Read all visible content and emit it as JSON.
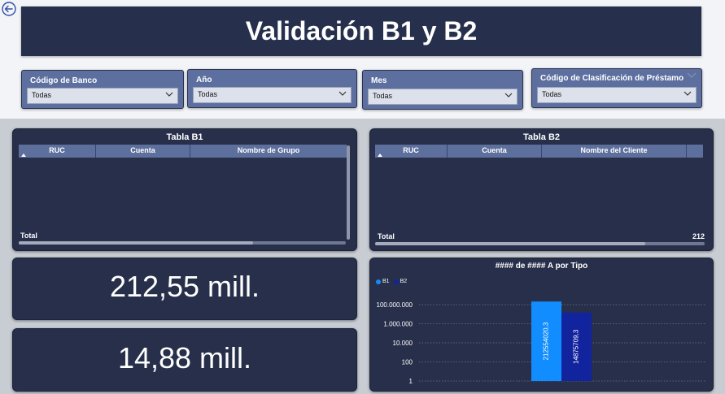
{
  "title": "Validación B1 y B2",
  "filters": [
    {
      "label": "Código de Banco",
      "value": "Todas"
    },
    {
      "label": "Año",
      "value": "Todas"
    },
    {
      "label": "Mes",
      "value": "Todas"
    },
    {
      "label": "Código de Clasificación de Préstamo",
      "value": "Todas"
    }
  ],
  "table_b1": {
    "title": "Tabla B1",
    "columns": [
      "RUC",
      "Cuenta",
      "Nombre de Grupo"
    ],
    "total_label": "Total",
    "total_value": ""
  },
  "table_b2": {
    "title": "Tabla B2",
    "columns": [
      "RUC",
      "Cuenta",
      "Nombre del Cliente"
    ],
    "total_label": "Total",
    "total_value": "212"
  },
  "cards": [
    {
      "value": "212,55 mill."
    },
    {
      "value": "14,88 mill."
    }
  ],
  "chart": {
    "title": "#### de #### A por Tipo"
  },
  "chart_data": {
    "type": "bar",
    "title": "#### de #### A por Tipo",
    "scale": "log",
    "y_ticks": [
      "1",
      "100",
      "10.000",
      "1.000.000",
      "100.000.000"
    ],
    "y_tick_values": [
      1,
      100,
      10000,
      1000000,
      100000000
    ],
    "ylim": [
      1,
      100000000
    ],
    "grid": true,
    "legend": "top-left",
    "series": [
      {
        "name": "B1",
        "value": 212554020.3,
        "label": "212554020,3",
        "color": "#118dff"
      },
      {
        "name": "B2",
        "value": 14875709.3,
        "label": "14875709,3",
        "color": "#12239e"
      }
    ]
  }
}
